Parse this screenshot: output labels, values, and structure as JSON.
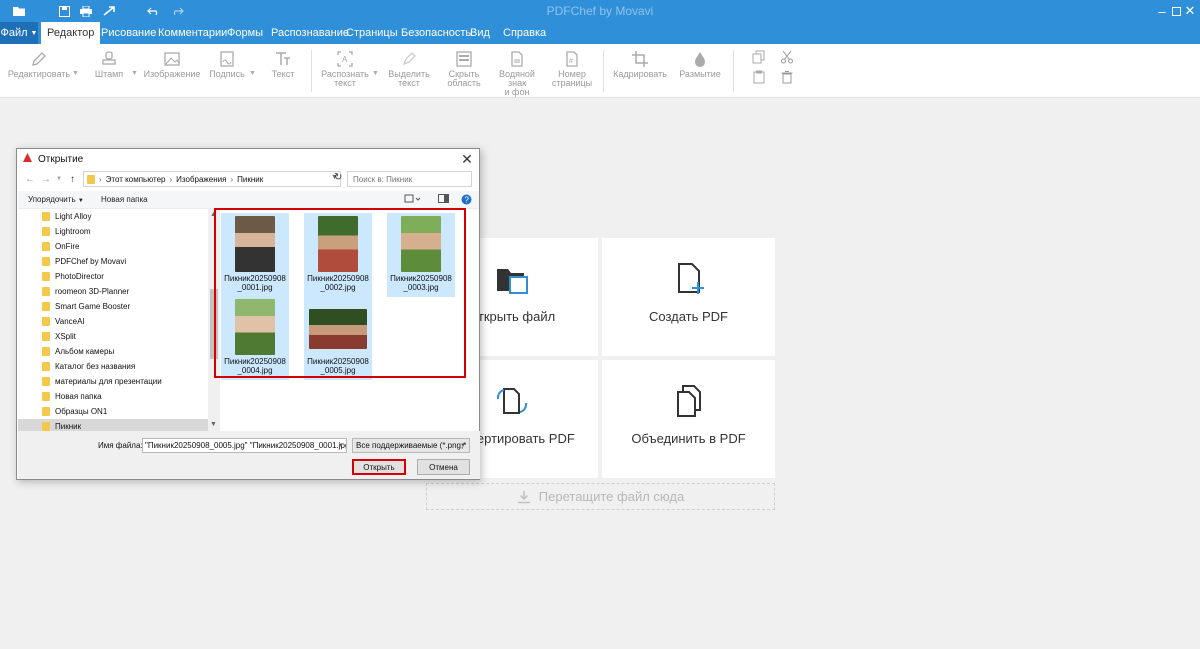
{
  "app": {
    "title": "PDFChef by Movavi"
  },
  "titlebar": {
    "icons": [
      "folder-open-icon",
      "save-icon",
      "print-icon",
      "share-icon",
      "undo-icon",
      "redo-icon"
    ],
    "window_controls": [
      "minimize-icon",
      "restore-icon",
      "close-icon"
    ]
  },
  "menu": {
    "file": "Файл",
    "tabs": [
      "Редактор",
      "Рисование",
      "Комментарии",
      "Формы",
      "Распознавание",
      "Страницы",
      "Безопасность",
      "Вид",
      "Справка"
    ]
  },
  "toolbar": {
    "edit": "Редактировать",
    "stamp": "Штамп",
    "image": "Изображение",
    "signature": "Подпись",
    "text": "Текст",
    "recognize_1": "Распознать",
    "recognize_2": "текст",
    "highlight_1": "Выделить",
    "highlight_2": "текст",
    "hide_1": "Скрыть",
    "hide_2": "область",
    "watermark_1": "Водяной знак",
    "watermark_2": "и фон",
    "pagenum_1": "Номер",
    "pagenum_2": "страницы",
    "crop": "Кадрировать",
    "blur": "Размытие"
  },
  "tiles": {
    "open": "Открыть файл",
    "create": "Создать PDF",
    "convert": "Конвертировать PDF",
    "merge": "Объединить в PDF",
    "drop": "Перетащите файл сюда"
  },
  "dialog": {
    "title": "Открытие",
    "path": [
      "Этот компьютер",
      "Изображения",
      "Пикник"
    ],
    "search_placeholder": "Поиск в: Пикник",
    "organize": "Упорядочить",
    "new_folder": "Новая папка",
    "folders": [
      "Light Alloy",
      "Lightroom",
      "OnFire",
      "PDFChef by Movavi",
      "PhotoDirector",
      "roomeon 3D-Planner",
      "Smart Game Booster",
      "VanceAI",
      "XSplit",
      "Альбом камеры",
      "Каталог без названия",
      "материалы для презентации",
      "Новая папка",
      "Образцы ON1",
      "Пикник"
    ],
    "selected_folder": "Пикник",
    "files": [
      "Пикник20250908_0001.jpg",
      "Пикник20250908_0002.jpg",
      "Пикник20250908_0003.jpg",
      "Пикник20250908_0004.jpg",
      "Пикник20250908_0005.jpg"
    ],
    "filename_label": "Имя файла:",
    "filename_value": "\"Пикник20250908_0005.jpg\" \"Пикник20250908_0001.jpg\"",
    "filetype": "Все поддерживаемые (*.png;*",
    "open_button": "Открыть",
    "cancel_button": "Отмена"
  },
  "colors": {
    "accent": "#2f8fd8",
    "highlight": "#d40000",
    "selection": "#cce8ff"
  }
}
